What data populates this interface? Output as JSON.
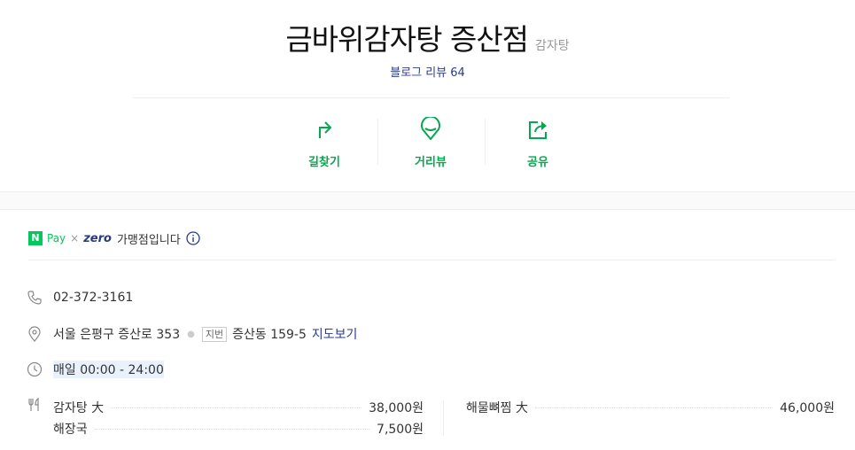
{
  "place": {
    "name": "금바위감자탕 증산점",
    "category": "감자탕",
    "review_label": "블로그 리뷰",
    "review_count": "64"
  },
  "actions": [
    {
      "label": "길찾기",
      "icon": "directions-icon"
    },
    {
      "label": "거리뷰",
      "icon": "streetview-pin-icon"
    },
    {
      "label": "공유",
      "icon": "share-icon"
    }
  ],
  "npay": {
    "n_mark": "N",
    "pay": "Pay",
    "x": "×",
    "zero": "zero",
    "member_text": "가맹점입니다"
  },
  "info": {
    "phone": "02-372-3161",
    "address": "서울 은평구 증산로 353",
    "jibun_badge": "지번",
    "jibun_address": "증산동 159-5",
    "map_link": "지도보기",
    "hours": "매일 00:00 - 24:00"
  },
  "menu": {
    "left": [
      {
        "name": "감자탕 大",
        "price": "38,000원"
      },
      {
        "name": "해장국",
        "price": "7,500원"
      }
    ],
    "right": [
      {
        "name": "해물뼈찜 大",
        "price": "46,000원"
      }
    ]
  },
  "colors": {
    "accent_green": "#03a94d",
    "link_blue": "#2b3a8f"
  }
}
